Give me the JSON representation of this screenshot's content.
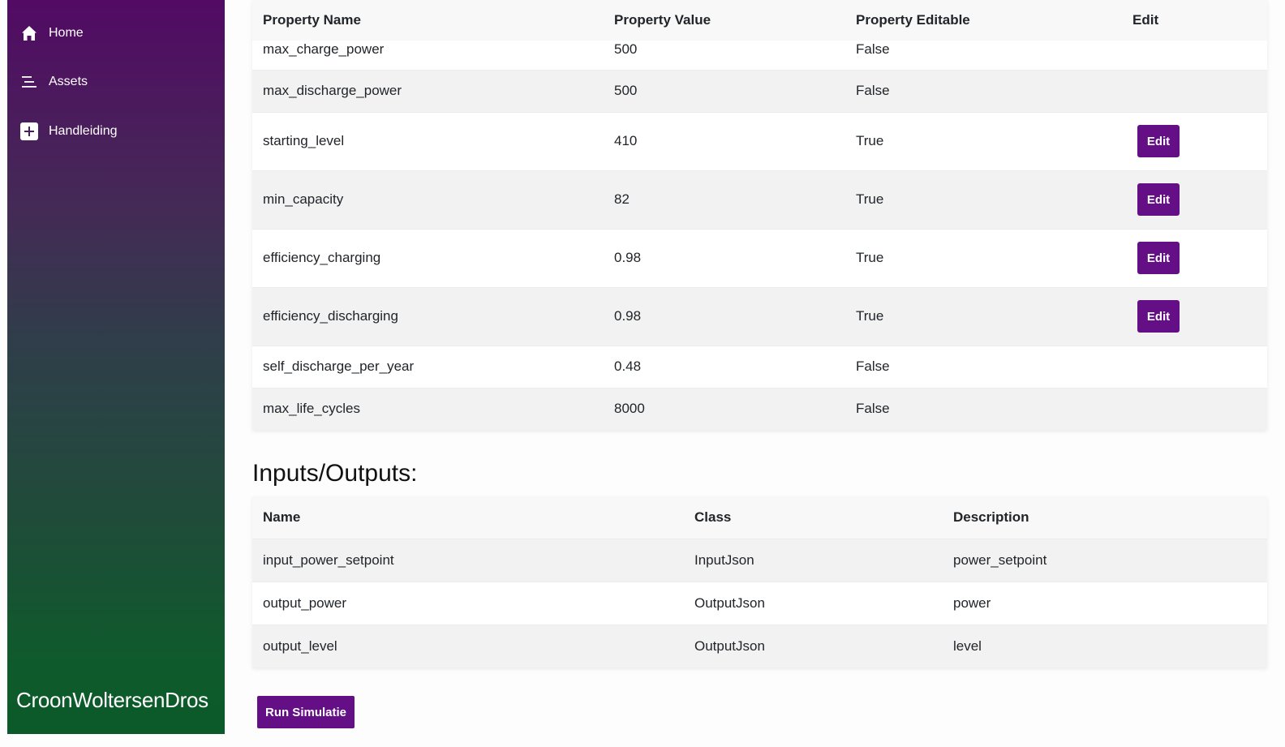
{
  "sidebar": {
    "items": [
      {
        "label": "Home",
        "icon": "home-icon"
      },
      {
        "label": "Assets",
        "icon": "list-icon"
      },
      {
        "label": "Handleiding",
        "icon": "plus-square-icon"
      }
    ],
    "brand": "CroonWoltersenDros"
  },
  "properties": {
    "headers": [
      "Property Name",
      "Property Value",
      "Property Editable",
      "Edit"
    ],
    "rows": [
      {
        "name": "max_charge_power",
        "value": "500",
        "editable": "False"
      },
      {
        "name": "max_discharge_power",
        "value": "500",
        "editable": "False"
      },
      {
        "name": "starting_level",
        "value": "410",
        "editable": "True",
        "edit_label": "Edit"
      },
      {
        "name": "min_capacity",
        "value": "82",
        "editable": "True",
        "edit_label": "Edit"
      },
      {
        "name": "efficiency_charging",
        "value": "0.98",
        "editable": "True",
        "edit_label": "Edit"
      },
      {
        "name": "efficiency_discharging",
        "value": "0.98",
        "editable": "True",
        "edit_label": "Edit"
      },
      {
        "name": "self_discharge_per_year",
        "value": "0.48",
        "editable": "False"
      },
      {
        "name": "max_life_cycles",
        "value": "8000",
        "editable": "False"
      }
    ]
  },
  "io": {
    "title": "Inputs/Outputs:",
    "headers": [
      "Name",
      "Class",
      "Description"
    ],
    "rows": [
      {
        "name": "input_power_setpoint",
        "class": "InputJson",
        "description": "power_setpoint"
      },
      {
        "name": "output_power",
        "class": "OutputJson",
        "description": "power"
      },
      {
        "name": "output_level",
        "class": "OutputJson",
        "description": "level"
      }
    ]
  },
  "actions": {
    "run_label": "Run Simulatie"
  },
  "colors": {
    "accent": "#650f86",
    "sidebar_top": "#520a64",
    "sidebar_bottom": "#0b5a29"
  }
}
